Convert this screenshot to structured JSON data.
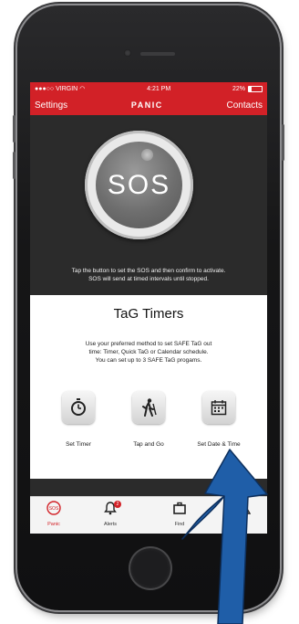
{
  "status_bar": {
    "carrier": "●●●○○ VIRGIN",
    "time": "4:21 PM",
    "battery_text": "22%",
    "battery_level": 0.22
  },
  "nav": {
    "left": "Settings",
    "title": "PANIC",
    "right": "Contacts"
  },
  "sos": {
    "button_label": "SOS",
    "instruction_line1": "Tap the button to set the SOS and then confirm to activate.",
    "instruction_line2": "SOS will send at timed intervals until stopped."
  },
  "tag": {
    "title": "TaG Timers",
    "desc_line1": "Use your preferred method to set SAFE TaG out",
    "desc_line2": "time: Timer, Quick TaG or Calendar schedule.",
    "desc_line3": "You can set up to 3 SAFE TaG progams.",
    "buttons": [
      {
        "label": "Set Timer",
        "icon": "stopwatch-icon"
      },
      {
        "label": "Tap and Go",
        "icon": "walking-person-icon"
      },
      {
        "label": "Set Date & Time",
        "icon": "calendar-icon"
      }
    ]
  },
  "tabbar": {
    "items": [
      {
        "label": "Panic",
        "icon": "sos-icon",
        "active": true
      },
      {
        "label": "Alerts",
        "icon": "bell-icon",
        "badge": "2"
      },
      {
        "label": "Find",
        "icon": "briefcase-icon"
      },
      {
        "label": "",
        "icon": "warning-icon"
      }
    ]
  },
  "colors": {
    "brand_red": "#d22127",
    "arrow_blue": "#1f5ea8"
  }
}
